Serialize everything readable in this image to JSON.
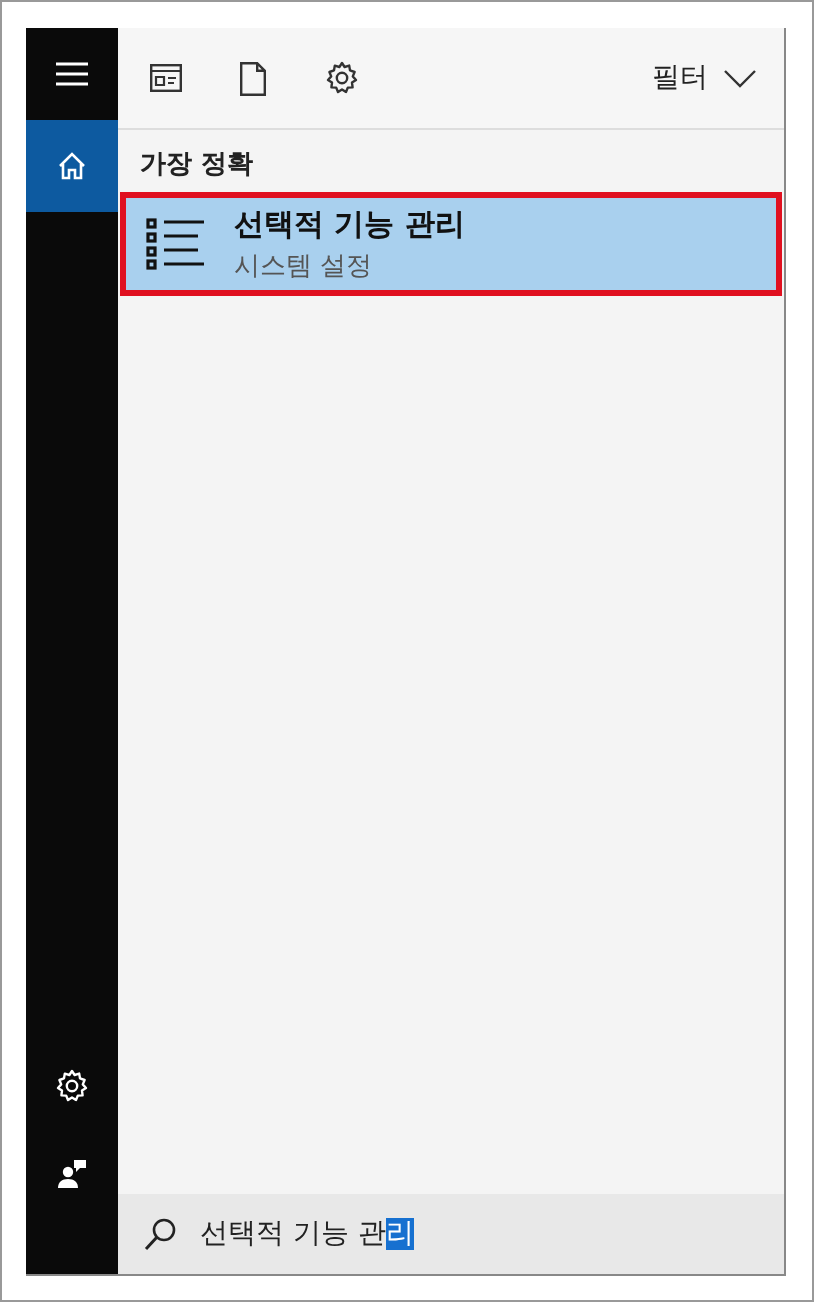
{
  "rail": {
    "items": [
      {
        "kind": "menu",
        "selected": false
      },
      {
        "kind": "home",
        "selected": true
      }
    ],
    "bottom": [
      {
        "kind": "settings"
      },
      {
        "kind": "feedback"
      }
    ]
  },
  "toolbar": {
    "icons": [
      {
        "kind": "app"
      },
      {
        "kind": "document"
      },
      {
        "kind": "settings"
      }
    ],
    "filter": "필터"
  },
  "section": "가장 정확",
  "results": [
    {
      "title": "선택적 기능 관리",
      "subtitle": "시스템 설정",
      "selected": true
    }
  ],
  "search": {
    "text": "선택적 기능 관",
    "composing": "리"
  }
}
